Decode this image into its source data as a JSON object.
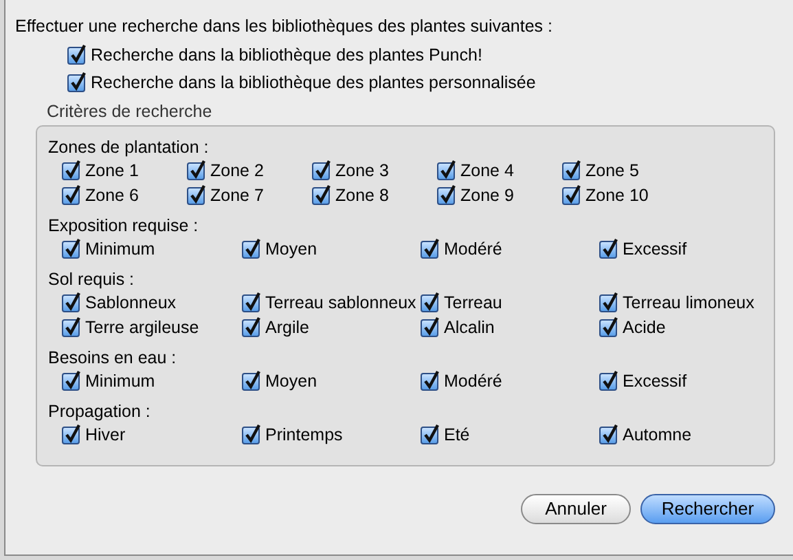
{
  "intro": "Effectuer une recherche dans les bibliothèques des plantes suivantes :",
  "libraries": [
    {
      "label": "Recherche dans la bibliothèque des plantes Punch!",
      "checked": true
    },
    {
      "label": "Recherche dans la bibliothèque des plantes personnalisée",
      "checked": true
    }
  ],
  "criteria": {
    "title": "Critères de recherche",
    "sections": [
      {
        "label": "Zones de plantation :",
        "options": [
          {
            "label": "Zone 1",
            "checked": true
          },
          {
            "label": "Zone 2",
            "checked": true
          },
          {
            "label": "Zone 3",
            "checked": true
          },
          {
            "label": "Zone 4",
            "checked": true
          },
          {
            "label": "Zone 5",
            "checked": true
          },
          {
            "label": "Zone 6",
            "checked": true
          },
          {
            "label": "Zone 7",
            "checked": true
          },
          {
            "label": "Zone 8",
            "checked": true
          },
          {
            "label": "Zone 9",
            "checked": true
          },
          {
            "label": "Zone 10",
            "checked": true
          }
        ]
      },
      {
        "label": "Exposition requise :",
        "options": [
          {
            "label": "Minimum",
            "checked": true
          },
          {
            "label": "Moyen",
            "checked": true
          },
          {
            "label": "Modéré",
            "checked": true
          },
          {
            "label": "Excessif",
            "checked": true
          }
        ]
      },
      {
        "label": "Sol requis :",
        "options": [
          {
            "label": "Sablonneux",
            "checked": true
          },
          {
            "label": "Terreau sablonneux",
            "checked": true
          },
          {
            "label": "Terreau",
            "checked": true
          },
          {
            "label": "Terreau limoneux",
            "checked": true
          },
          {
            "label": "Terre argileuse",
            "checked": true
          },
          {
            "label": "Argile",
            "checked": true
          },
          {
            "label": "Alcalin",
            "checked": true
          },
          {
            "label": "Acide",
            "checked": true
          }
        ]
      },
      {
        "label": "Besoins en eau :",
        "options": [
          {
            "label": "Minimum",
            "checked": true
          },
          {
            "label": "Moyen",
            "checked": true
          },
          {
            "label": "Modéré",
            "checked": true
          },
          {
            "label": "Excessif",
            "checked": true
          }
        ]
      },
      {
        "label": "Propagation :",
        "options": [
          {
            "label": "Hiver",
            "checked": true
          },
          {
            "label": "Printemps",
            "checked": true
          },
          {
            "label": "Eté",
            "checked": true
          },
          {
            "label": "Automne",
            "checked": true
          }
        ]
      }
    ]
  },
  "buttons": [
    {
      "label": "Annuler",
      "kind": "normal"
    },
    {
      "label": "Rechercher",
      "kind": "default"
    }
  ]
}
